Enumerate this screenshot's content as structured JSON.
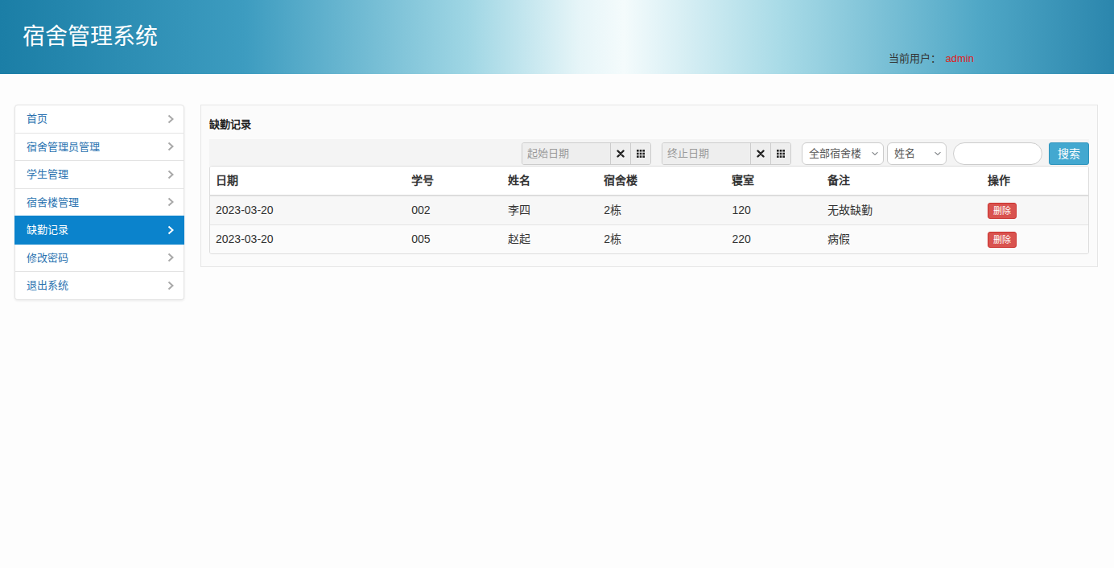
{
  "header": {
    "title": "宿舍管理系统",
    "user_label": "当前用户：",
    "user": "admin"
  },
  "sidebar": {
    "items": [
      {
        "label": "首页",
        "selected": false
      },
      {
        "label": "宿舍管理员管理",
        "selected": false
      },
      {
        "label": "学生管理",
        "selected": false
      },
      {
        "label": "宿舍楼管理",
        "selected": false
      },
      {
        "label": "缺勤记录",
        "selected": true
      },
      {
        "label": "修改密码",
        "selected": false
      },
      {
        "label": "退出系统",
        "selected": false
      }
    ]
  },
  "panel": {
    "title": "缺勤记录"
  },
  "toolbar": {
    "start_date": {
      "placeholder": "起始日期"
    },
    "end_date": {
      "placeholder": "终止日期"
    },
    "building": "全部宿舍楼",
    "field": "姓名",
    "search_button": "搜索"
  },
  "table": {
    "columns": [
      "日期",
      "学号",
      "姓名",
      "宿舍楼",
      "寝室",
      "备注",
      "操作"
    ],
    "rows": [
      [
        "2023-03-20",
        "002",
        "李四",
        "2栋",
        "120",
        "无故缺勤",
        "删除"
      ],
      [
        "2023-03-20",
        "005",
        "赵起",
        "2栋",
        "220",
        "病假",
        "删除"
      ]
    ]
  }
}
